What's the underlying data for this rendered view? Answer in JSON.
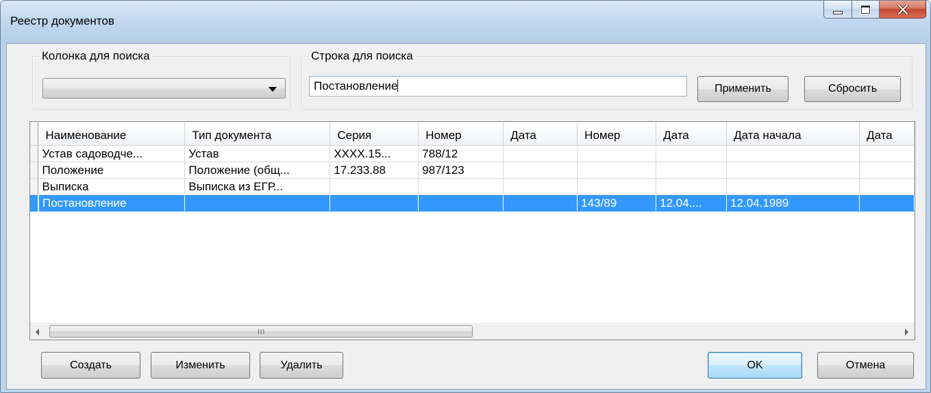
{
  "window": {
    "title": "Реестр документов",
    "controls": {
      "minimize": "minimize",
      "maximize": "maximize",
      "close": "close"
    }
  },
  "search": {
    "column_group_label": "Колонка для поиска",
    "column_selected": "",
    "string_group_label": "Строка для поиска",
    "string_value": "Постановление",
    "apply_label": "Применить",
    "reset_label": "Сбросить"
  },
  "grid": {
    "columns": [
      "Наименование",
      "Тип документа",
      "Серия",
      "Номер",
      "Дата",
      "Номер",
      "Дата",
      "Дата начала",
      "Дата"
    ],
    "rows": [
      [
        "Устав садоводче...",
        "Устав",
        "XXXX.15...",
        "788/12",
        "",
        "",
        "",
        "",
        ""
      ],
      [
        "Положение",
        "Положение (общ...",
        "17.233.88",
        "987/123",
        "",
        "",
        "",
        "",
        ""
      ],
      [
        "Выписка",
        "Выписка из ЕГР...",
        "",
        "",
        "",
        "",
        "",
        "",
        ""
      ],
      [
        "Постановление",
        "",
        "",
        "",
        "",
        "143/89",
        "12.04....",
        "12.04.1989",
        ""
      ]
    ],
    "selected_row": 3,
    "scroll_grip": "III"
  },
  "footer": {
    "create_label": "Создать",
    "edit_label": "Изменить",
    "delete_label": "Удалить",
    "ok_label": "OK",
    "cancel_label": "Отмена"
  },
  "colors": {
    "selection": "#3399ff",
    "client_bg": "#f0f0f0",
    "title_bg": "#c2d8ef"
  }
}
